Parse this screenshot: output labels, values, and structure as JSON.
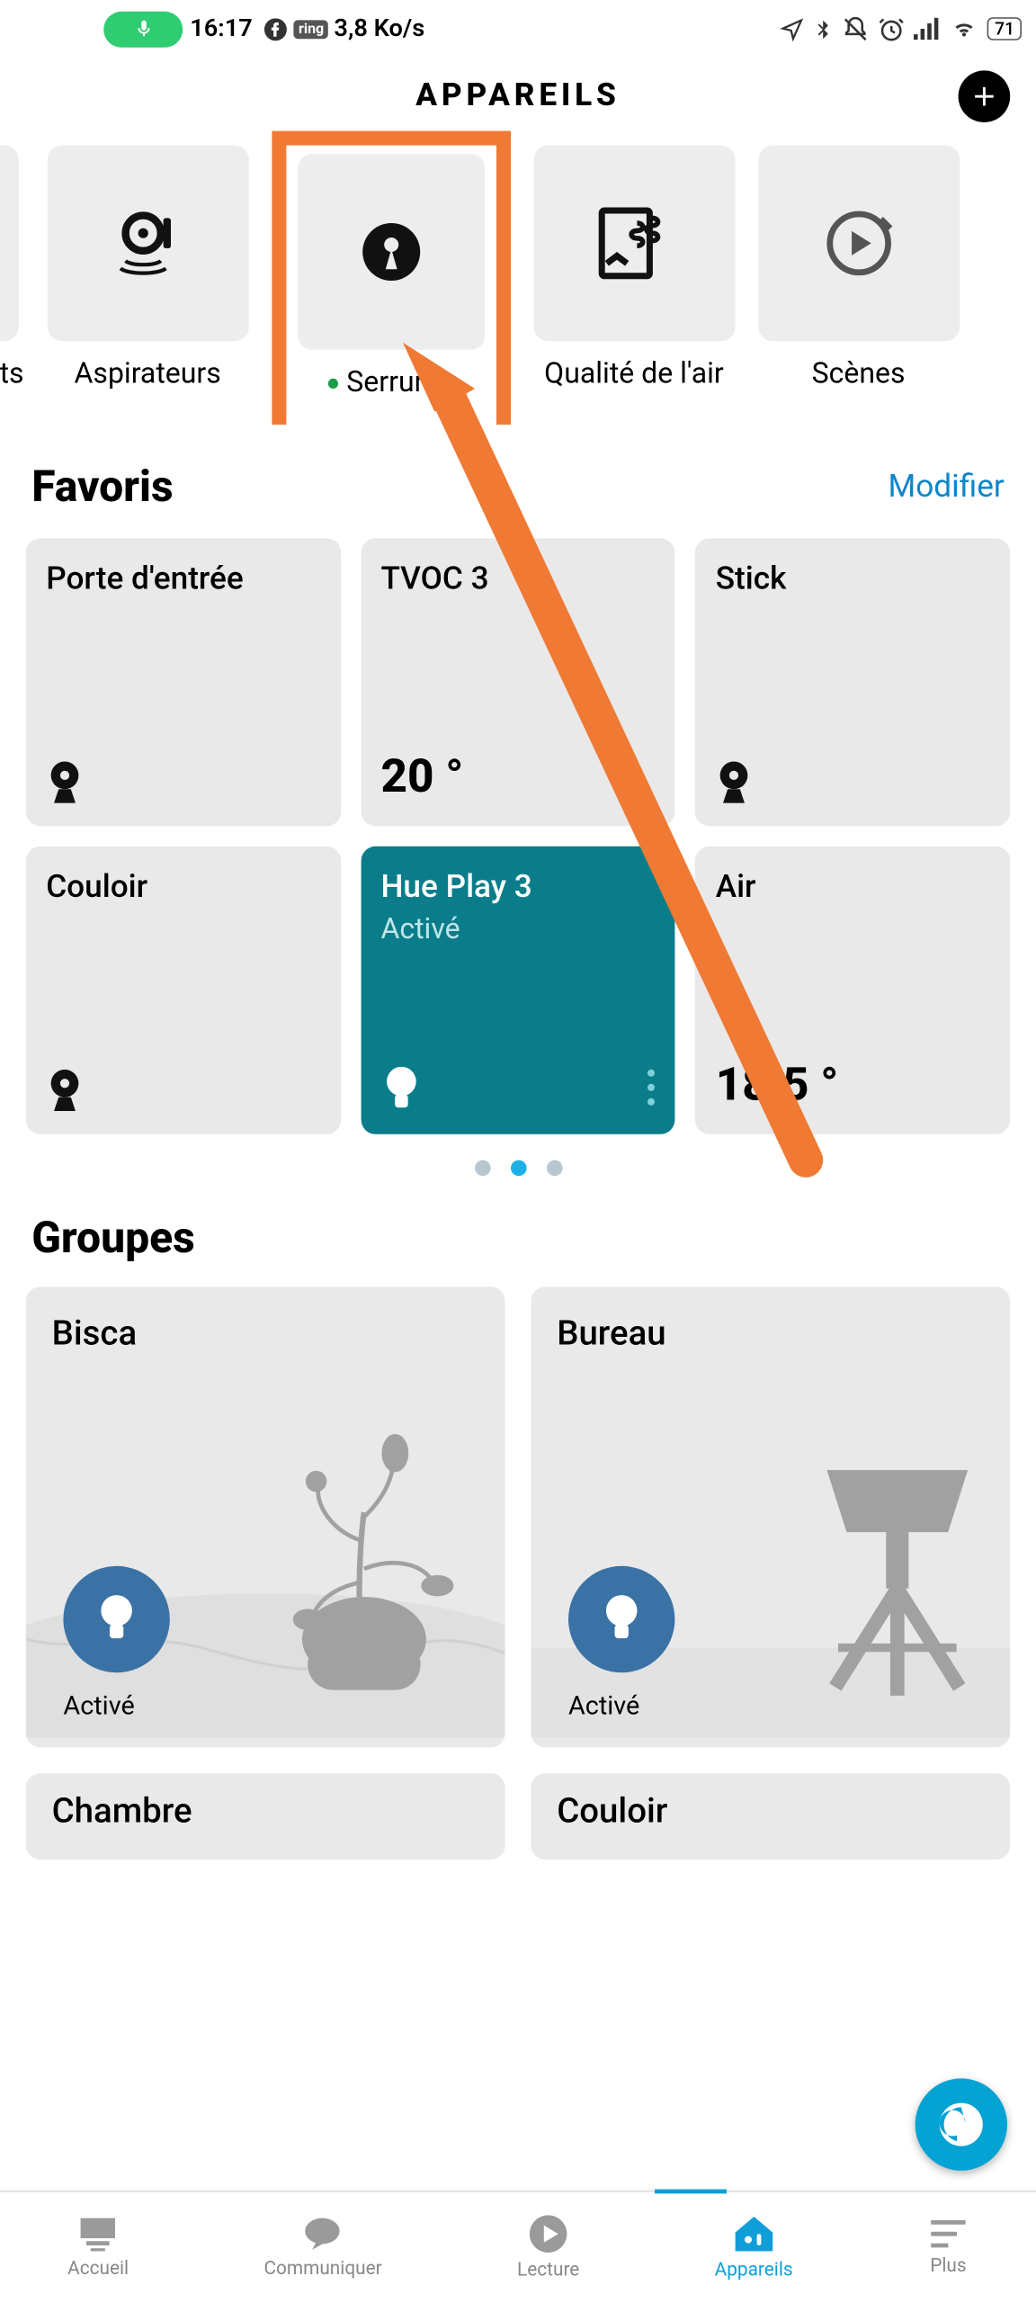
{
  "status": {
    "time": "16:17",
    "net_speed": "3,8 Ko/s",
    "battery": "71"
  },
  "header": {
    "title": "APPAREILS"
  },
  "categories": [
    {
      "label": "stats"
    },
    {
      "label": "Aspirateurs"
    },
    {
      "label": "Serrures"
    },
    {
      "label": "Qualité de l'air"
    },
    {
      "label": "Scènes"
    }
  ],
  "favorites": {
    "title": "Favoris",
    "edit_label": "Modifier",
    "tiles": [
      {
        "name": "Porte d'entrée"
      },
      {
        "name": "TVOC 3",
        "value": "20 °"
      },
      {
        "name": "Stick"
      },
      {
        "name": "Couloir"
      },
      {
        "name": "Hue Play 3",
        "state": "Activé"
      },
      {
        "name": "Air",
        "value": "18.5 °"
      }
    ]
  },
  "groups": {
    "title": "Groupes",
    "tiles": [
      {
        "name": "Bisca",
        "state": "Activé"
      },
      {
        "name": "Bureau",
        "state": "Activé"
      },
      {
        "name": "Chambre"
      },
      {
        "name": "Couloir"
      }
    ]
  },
  "nav": {
    "home": "Accueil",
    "communicate": "Communiquer",
    "play": "Lecture",
    "devices": "Appareils",
    "more": "Plus"
  }
}
